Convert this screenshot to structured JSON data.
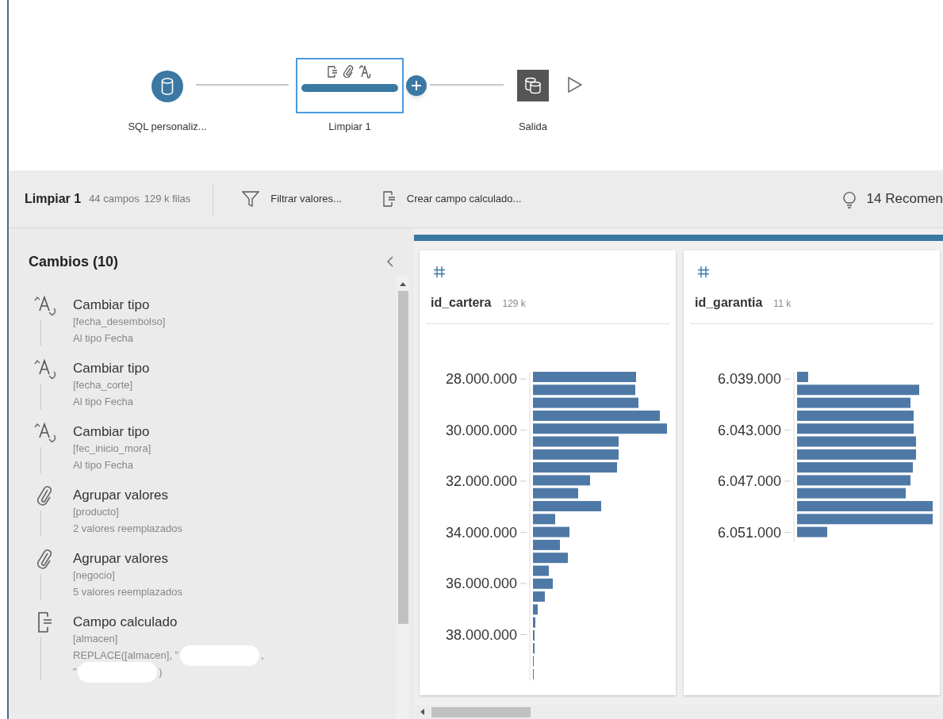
{
  "flow": {
    "nodes": [
      {
        "kind": "input",
        "label": "SQL personaliz...",
        "selected": false
      },
      {
        "kind": "clean",
        "label": "Limpiar 1",
        "selected": true
      },
      {
        "kind": "output",
        "label": "Salida",
        "selected": false
      }
    ]
  },
  "toolbar": {
    "title": "Limpiar 1",
    "fields": "44 campos",
    "rows": "129 k filas",
    "actions": [
      {
        "kind": "filter",
        "label": "Filtrar valores..."
      },
      {
        "kind": "calc",
        "label": "Crear campo calculado..."
      }
    ],
    "recommendations": "14 Recomen"
  },
  "changes": {
    "title": "Cambios (10)",
    "items": [
      {
        "kind": "type",
        "title": "Cambiar tipo",
        "field": "[fecha_desembolso]",
        "detail": [
          [
            {
              "kind": "text",
              "text": "Al tipo Fecha"
            }
          ]
        ]
      },
      {
        "kind": "type",
        "title": "Cambiar tipo",
        "field": "[fecha_corte]",
        "detail": [
          [
            {
              "kind": "text",
              "text": "Al tipo Fecha"
            }
          ]
        ]
      },
      {
        "kind": "type",
        "title": "Cambiar tipo",
        "field": "[fec_inicio_mora]",
        "detail": [
          [
            {
              "kind": "text",
              "text": "Al tipo Fecha"
            }
          ]
        ]
      },
      {
        "kind": "group",
        "title": "Agrupar valores",
        "field": "[producto]",
        "detail": [
          [
            {
              "kind": "text",
              "text": "2 valores reemplazados"
            }
          ]
        ]
      },
      {
        "kind": "group",
        "title": "Agrupar valores",
        "field": "[negocio]",
        "detail": [
          [
            {
              "kind": "text",
              "text": "5 valores reemplazados"
            }
          ]
        ]
      },
      {
        "kind": "calc",
        "title": "Campo calculado",
        "field": "[almacen]",
        "detail": [
          [
            {
              "kind": "text",
              "text": "REPLACE([almacen], ”"
            },
            {
              "kind": "redacted"
            },
            {
              "kind": "text",
              "text": ","
            }
          ],
          [
            {
              "kind": "text",
              "text": "”"
            },
            {
              "kind": "redacted"
            },
            {
              "kind": "text",
              "text": ")"
            }
          ]
        ]
      }
    ]
  },
  "profile": {
    "cards": [
      {
        "kind": "number",
        "name": "id_cartera",
        "count": "129 k",
        "ticks": [
          "28.000.000",
          "30.000.000",
          "32.000.000",
          "34.000.000",
          "36.000.000",
          "38.000.000"
        ]
      },
      {
        "kind": "number",
        "name": "id_garantia",
        "count": "11 k",
        "ticks": [
          "6.039.000",
          "6.043.000",
          "6.047.000",
          "6.051.000"
        ]
      }
    ]
  }
}
